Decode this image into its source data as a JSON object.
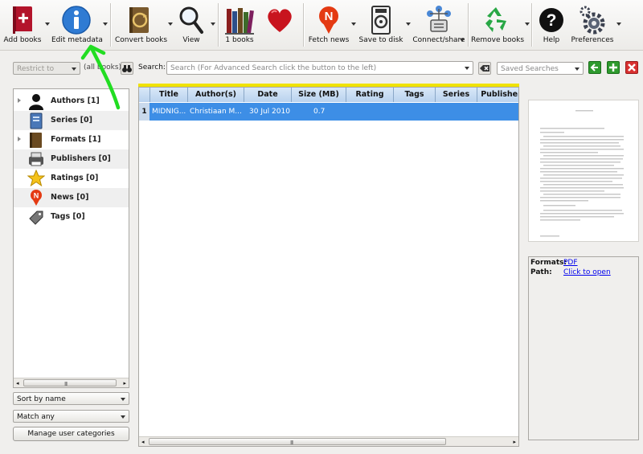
{
  "toolbar": {
    "buttons": [
      {
        "label": "Add books"
      },
      {
        "label": "Edit metadata"
      },
      {
        "label": "Convert books"
      },
      {
        "label": "View"
      },
      {
        "label": "1 books"
      },
      {
        "label": "Fetch news"
      },
      {
        "label": "Save to disk"
      },
      {
        "label": "Connect/share"
      },
      {
        "label": "Remove books"
      },
      {
        "label": "Help"
      },
      {
        "label": "Preferences"
      }
    ]
  },
  "searchbar": {
    "restrict_to": "Restrict to",
    "all_books": "(all books)",
    "search_label": "Search:",
    "search_placeholder": "Search (For Advanced Search click the button to the left)",
    "saved_searches": "Saved Searches"
  },
  "tag_browser": {
    "categories": [
      {
        "label": "Authors [1]",
        "icon": "user-icon",
        "expandable": true
      },
      {
        "label": "Series [0]",
        "icon": "series-icon",
        "expandable": false
      },
      {
        "label": "Formats [1]",
        "icon": "book-icon",
        "expandable": true
      },
      {
        "label": "Publishers [0]",
        "icon": "publisher-icon",
        "expandable": false
      },
      {
        "label": "Ratings [0]",
        "icon": "star-icon",
        "expandable": false
      },
      {
        "label": "News [0]",
        "icon": "news-icon",
        "expandable": false
      },
      {
        "label": "Tags [0]",
        "icon": "tag-icon",
        "expandable": false
      }
    ],
    "sort_by": "Sort by name",
    "match": "Match any",
    "manage_button": "Manage user categories",
    "scroll_grip": "III"
  },
  "book_table": {
    "columns": [
      "Title",
      "Author(s)",
      "Date",
      "Size (MB)",
      "Rating",
      "Tags",
      "Series",
      "Publisher"
    ],
    "rows": [
      {
        "num": "1",
        "title": "MIDNIG...",
        "author": "Christiaan M...",
        "date": "30 Jul 2010",
        "size": "0.7",
        "rating": "",
        "tags": "",
        "series": "",
        "publisher": ""
      }
    ],
    "scroll_grip": "III"
  },
  "book_details": {
    "formats_label": "Formats:",
    "formats_value": "PDF",
    "path_label": "Path:",
    "path_value": "Click to open"
  },
  "colors": {
    "selection": "#3d8ee6",
    "annotation_arrow": "#22dd22",
    "header_highlight": "#f0e200"
  }
}
